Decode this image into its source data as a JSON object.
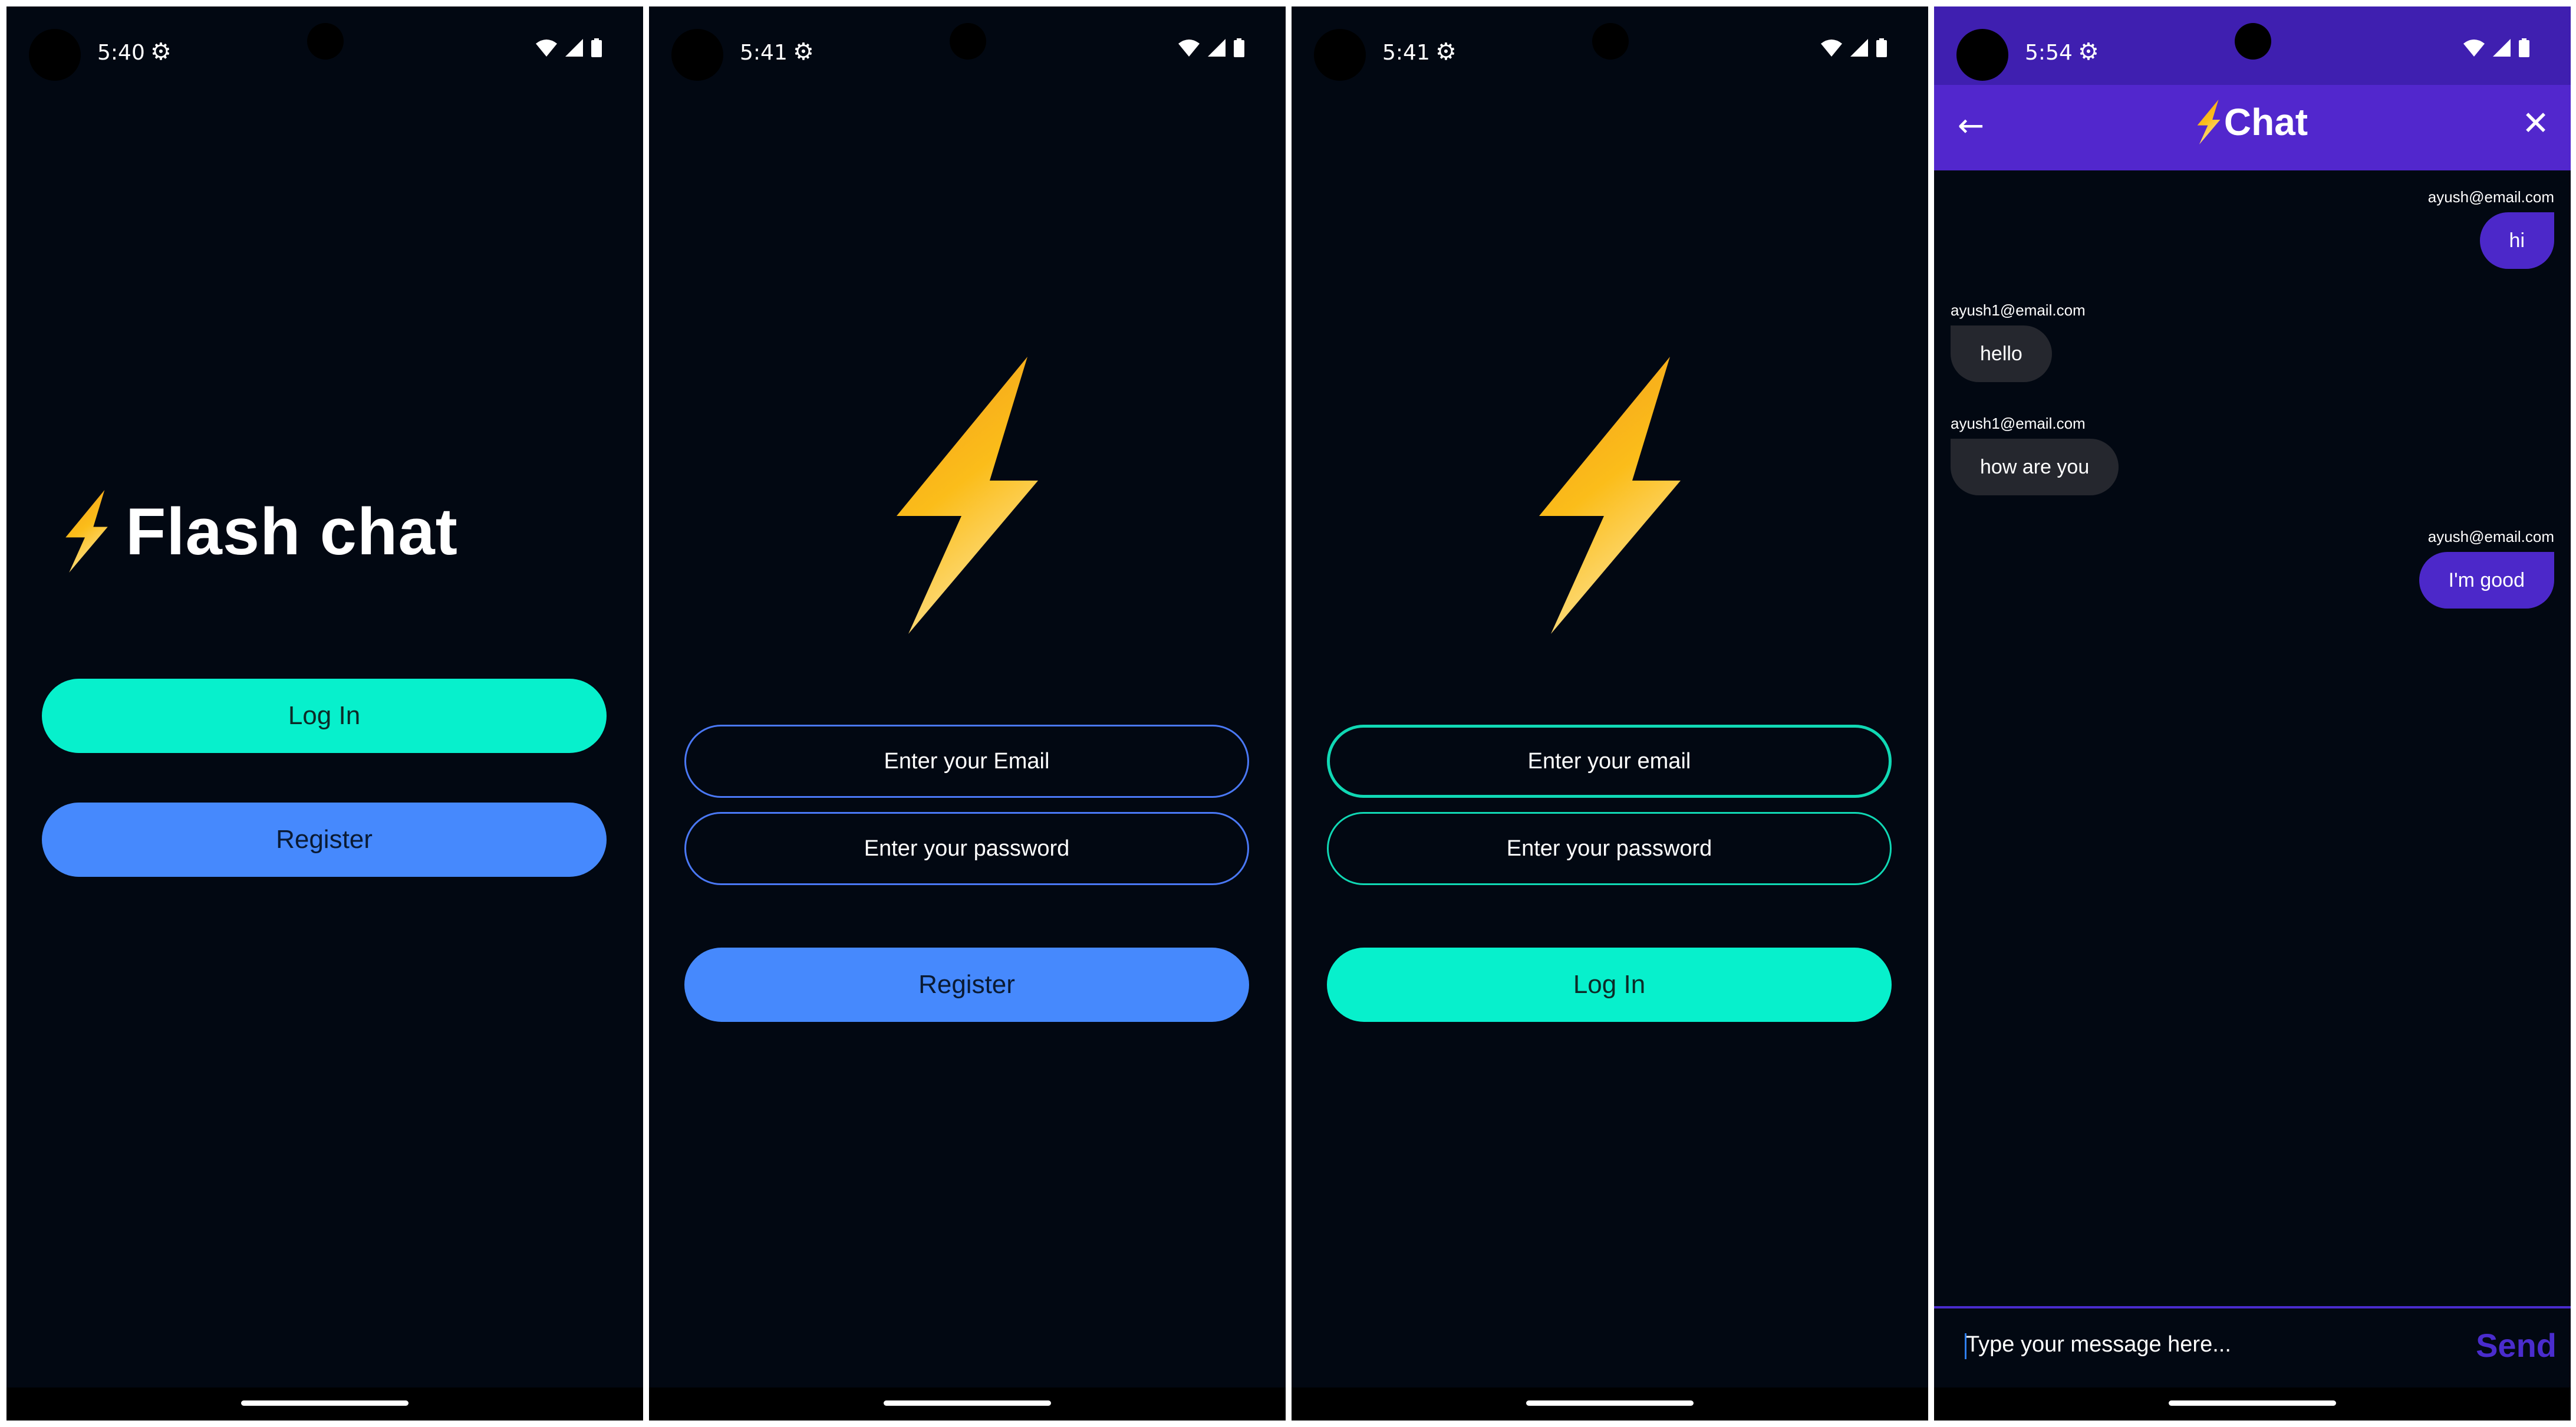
{
  "screens": [
    {
      "status": {
        "time": "5:40"
      },
      "brand": {
        "title": "Flash chat"
      },
      "buttons": {
        "login": "Log In",
        "register": "Register"
      }
    },
    {
      "status": {
        "time": "5:41"
      },
      "fields": {
        "email_placeholder": "Enter your Email",
        "password_placeholder": "Enter your password"
      },
      "buttons": {
        "register": "Register"
      }
    },
    {
      "status": {
        "time": "5:41"
      },
      "fields": {
        "email_placeholder": "Enter your email",
        "password_placeholder": "Enter your password"
      },
      "buttons": {
        "login": "Log In"
      }
    },
    {
      "status": {
        "time": "5:54"
      },
      "appbar": {
        "title": "Chat",
        "back_icon": "arrow-left-icon",
        "close_icon": "close-icon"
      },
      "messages": [
        {
          "sender": "ayush@email.com",
          "text": "hi",
          "is_me": true
        },
        {
          "sender": "ayush1@email.com",
          "text": "hello",
          "is_me": false
        },
        {
          "sender": "ayush1@email.com",
          "text": "how are you",
          "is_me": false
        },
        {
          "sender": "ayush@email.com",
          "text": "I'm good",
          "is_me": true
        }
      ],
      "composer": {
        "placeholder": "Type your message here...",
        "send_label": "Send"
      }
    }
  ],
  "colors": {
    "background": "#020812",
    "teal": "#07f0cc",
    "blue": "#4689fd",
    "purple": "#5227cd",
    "bubble_me": "#4c28c9",
    "bubble_them": "#25272e"
  }
}
